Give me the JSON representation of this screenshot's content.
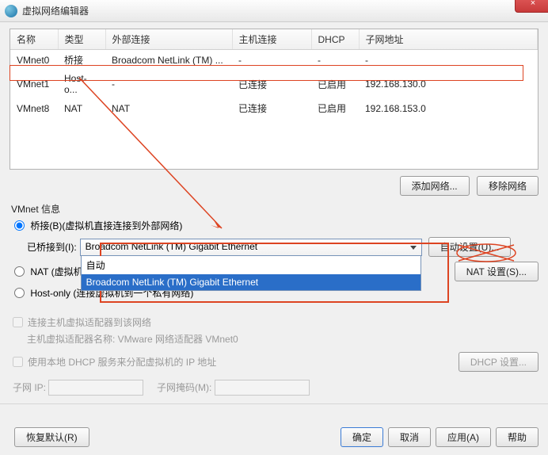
{
  "window": {
    "title": "虚拟网络编辑器",
    "close": "×"
  },
  "table": {
    "headers": [
      "名称",
      "类型",
      "外部连接",
      "主机连接",
      "DHCP",
      "子网地址"
    ],
    "rows": [
      {
        "name": "VMnet0",
        "type": "桥接",
        "ext": "Broadcom NetLink (TM) ...",
        "host": "-",
        "dhcp": "-",
        "subnet": "-"
      },
      {
        "name": "VMnet1",
        "type": "Host-o...",
        "ext": "-",
        "host": "已连接",
        "dhcp": "已启用",
        "subnet": "192.168.130.0"
      },
      {
        "name": "VMnet8",
        "type": "NAT",
        "ext": "NAT",
        "host": "已连接",
        "dhcp": "已启用",
        "subnet": "192.168.153.0"
      }
    ]
  },
  "buttons": {
    "add_net": "添加网络...",
    "remove_net": "移除网络",
    "auto_set": "自动设置(U)...",
    "nat_set": "NAT 设置(S)...",
    "dhcp_set": "DHCP 设置...",
    "restore": "恢复默认(R)",
    "ok": "确定",
    "cancel": "取消",
    "apply": "应用(A)",
    "help": "帮助"
  },
  "vmnet": {
    "section_label": "VMnet 信息",
    "radio_bridge": "桥接(B)(虚拟机直接连接到外部网络)",
    "bridged_to_label": "已桥接到(I):",
    "bridged_selected": "Broadcom NetLink (TM) Gigabit Ethernet",
    "dd_option_auto": "自动",
    "dd_option_sel": "Broadcom NetLink (TM) Gigabit Ethernet",
    "radio_nat": "NAT (虚拟机使",
    "radio_host": "Host-only (连接虚拟机到一个私有网络)",
    "chk_connect_host": "连接主机虚拟适配器到该网络",
    "host_adapter_label": "主机虚拟适配器名称: VMware 网络适配器 VMnet0",
    "chk_use_dhcp": "使用本地 DHCP 服务来分配虚拟机的 IP 地址",
    "subnet_ip_label": "子网 IP:",
    "subnet_mask_label": "子网掩码(M):"
  }
}
